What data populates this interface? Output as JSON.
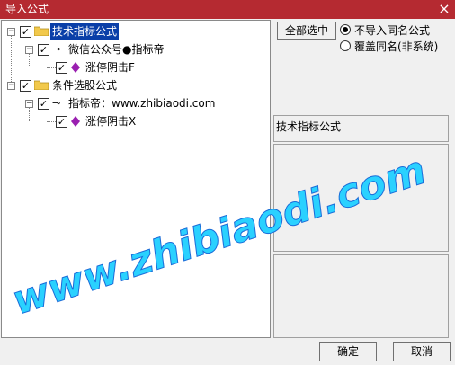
{
  "window": {
    "title": "导入公式"
  },
  "tree": {
    "nodes": [
      {
        "label": "技术指标公式"
      },
      {
        "label": "微信公众号●指标帝"
      },
      {
        "label": "涨停阴击F"
      },
      {
        "label": "条件选股公式"
      },
      {
        "label": "指标帝：www.zhibiaodi.com"
      },
      {
        "label": "涨停阴击X"
      }
    ]
  },
  "side": {
    "select_all_label": "全部选中",
    "radio_options": [
      {
        "label": "不导入同名公式",
        "selected": true
      },
      {
        "label": "覆盖同名(非系统)",
        "selected": false
      }
    ],
    "category_label": "技术指标公式"
  },
  "footer": {
    "ok_label": "确定",
    "cancel_label": "取消"
  },
  "watermark": {
    "text": "www.zhibiaodi.com"
  },
  "colors": {
    "titlebar": "#b52a31",
    "selection": "#0a3fa8",
    "folder": "#f2c94c",
    "diamond": "#9a1fb0",
    "watermark": "#2ad1ff"
  }
}
